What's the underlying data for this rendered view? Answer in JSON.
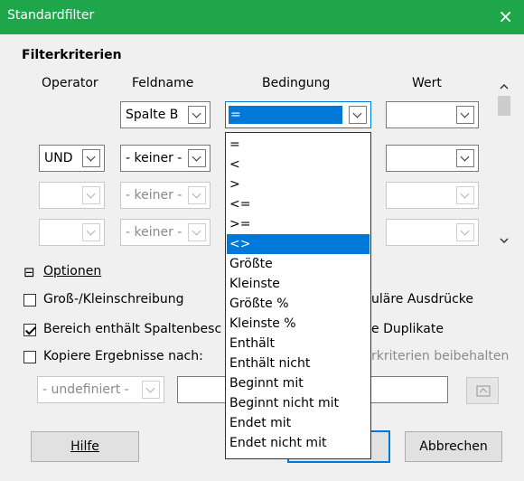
{
  "window": {
    "title": "Standardfilter",
    "close_icon": "×"
  },
  "criteria": {
    "title": "Filterkriterien",
    "headers": {
      "operator": "Operator",
      "fieldname": "Feldname",
      "condition": "Bedingung",
      "value": "Wert"
    },
    "rows": [
      {
        "operator": "",
        "fieldname": "Spalte B",
        "condition": "=",
        "value": ""
      },
      {
        "operator": "UND",
        "fieldname": "- keiner -",
        "condition": "",
        "value": ""
      },
      {
        "operator": "",
        "fieldname": "- keiner -",
        "condition": "",
        "value": ""
      },
      {
        "operator": "",
        "fieldname": "- keiner -",
        "condition": "",
        "value": ""
      }
    ]
  },
  "condition_dropdown": {
    "selected": "<>",
    "items": [
      "=",
      "<",
      ">",
      "<=",
      ">=",
      "<>",
      "Größte",
      "Kleinste",
      "Größte %",
      "Kleinste %",
      "Enthält",
      "Enthält nicht",
      "Beginnt mit",
      "Beginnt nicht mit",
      "Endet mit",
      "Endet nicht mit"
    ]
  },
  "options": {
    "toggle_icon": "⊟",
    "title": "Optionen",
    "case_sensitive": {
      "label": "Groß-/Kleinschreibung",
      "checked": false
    },
    "has_headers": {
      "label": "Bereich enthält Spaltenbeschriftungen",
      "label_visible": "Bereich enthält Spaltenbesc",
      "checked": true
    },
    "copy_results": {
      "label": "Kopiere Ergebnisse nach:",
      "checked": false
    },
    "regex": {
      "label_visible": "uläre Ausdrücke"
    },
    "no_duplicates": {
      "label_visible": "e Duplikate"
    },
    "keep_criteria": {
      "label_visible": "rkriterien beibehalten"
    },
    "copy_target": "- undefiniert -"
  },
  "buttons": {
    "help": "Hilfe",
    "cancel": "Abbrechen"
  }
}
